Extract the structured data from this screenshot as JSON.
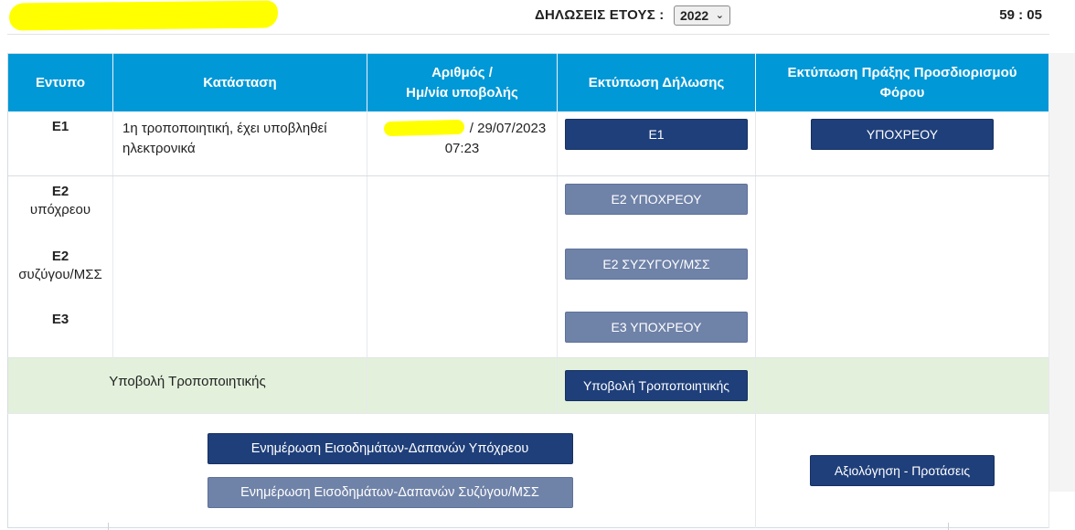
{
  "header": {
    "year_label": "ΔΗΛΩΣΕΙΣ ΕΤΟΥΣ :",
    "year_selected": "2022",
    "timer": "59 : 05"
  },
  "table": {
    "headers": {
      "form": "Εντυπο",
      "status": "Κατάσταση",
      "number_line1": "Αριθμός /",
      "number_line2": "Ημ/νία υποβολής",
      "print_decl": "Εκτύπωση Δήλωσης",
      "print_act_line1": "Εκτύπωση Πράξης Προσδιορισμού",
      "print_act_line2": "Φόρου"
    },
    "e1": {
      "code": "Ε1",
      "status_line1": "1η τροποποιητική, έχει υποβληθεί",
      "status_line2": "ηλεκτρονικά",
      "submission_date": "/ 29/07/2023",
      "submission_time": "07:23",
      "print_button": "Ε1",
      "act_button": "ΥΠΟΧΡΕΟΥ"
    },
    "e2_obliged": {
      "code": "Ε2",
      "sub": "υπόχρεου",
      "print_button": "Ε2 ΥΠΟΧΡΕΟΥ"
    },
    "e2_spouse": {
      "code": "Ε2",
      "sub": "συζύγου/ΜΣΣ",
      "print_button": "Ε2 ΣΥΖΥΓΟΥ/ΜΣΣ"
    },
    "e3": {
      "code": "Ε3",
      "print_button": "Ε3 ΥΠΟΧΡΕΟΥ"
    },
    "submit_row": {
      "label": "Υποβολή Τροποποιητικής",
      "button": "Υποβολή Τροποποιητικής"
    },
    "actions": {
      "update_obliged": "Ενημέρωση Εισοδημάτων-Δαπανών Υπόχρεου",
      "update_spouse": "Ενημέρωση Εισοδημάτων-Δαπανών Συζύγου/ΜΣΣ",
      "evaluation": "Αξιολόγηση - Προτάσεις"
    }
  },
  "colors": {
    "header_blue": "#0098d6",
    "button_dark": "#1f3f7a",
    "button_light": "#6f82a8",
    "submit_row_green": "#e3f1dc",
    "redaction_yellow": "#ffff00"
  }
}
